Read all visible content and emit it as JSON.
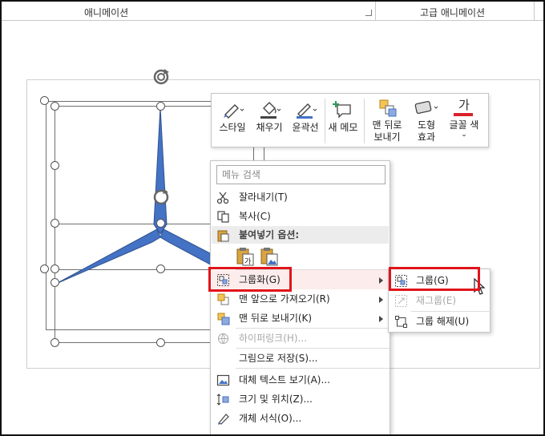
{
  "ribbon": {
    "group_animation": "애니메이션",
    "group_advanced": "고급 애니메이션"
  },
  "mini_toolbar": {
    "style": "스타일",
    "fill": "채우기",
    "outline": "윤곽선",
    "new_memo": "새 메모",
    "send_back_line1": "맨 뒤로",
    "send_back_line2": "보내기",
    "effects_line1": "도형",
    "effects_line2": "효과",
    "font_color": "글꼴 색",
    "font_color_glyph": "가",
    "font_color_value": "#d9222a"
  },
  "context_menu": {
    "search_placeholder": "메뉴 검색",
    "cut": "잘라내기(T)",
    "copy": "복사(C)",
    "paste_options": "붙여넣기 옵션:",
    "group": "그룹화(G)",
    "bring_front": "맨 앞으로 가져오기(R)",
    "send_back": "맨 뒤로 보내기(K)",
    "hyperlink": "하이퍼링크(H)...",
    "save_as_picture": "그림으로 저장(S)...",
    "alt_text": "대체 텍스트 보기(A)...",
    "size_position": "크기 및 위치(Z)...",
    "format_object": "개체 서식(O)..."
  },
  "group_submenu": {
    "group": "그룹(G)",
    "regroup": "재그룹(E)",
    "ungroup": "그룹 해제(U)"
  },
  "colors": {
    "shape_fill": "#4472c4",
    "highlight_red": "#e0151a"
  }
}
